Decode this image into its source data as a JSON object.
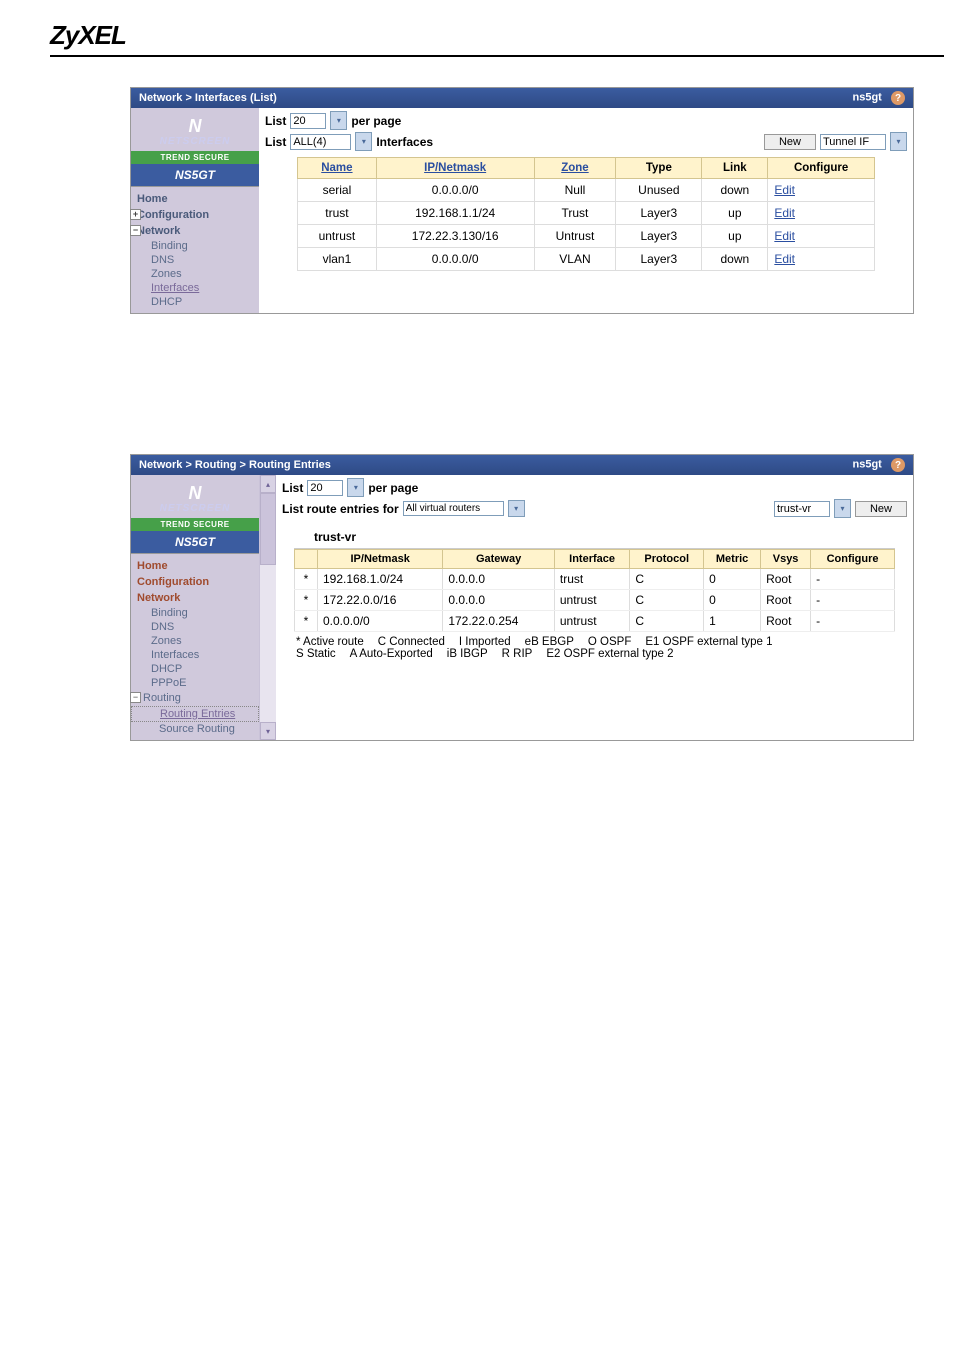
{
  "brand": "ZyXEL",
  "panel1": {
    "breadcrumb": "Network > Interfaces (List)",
    "hostname": "ns5gt",
    "list_label": "List",
    "page_size": "20",
    "per_page": "per page",
    "filter_value": "ALL(4)",
    "section_label": "Interfaces",
    "new_button": "New",
    "type_select": "Tunnel IF",
    "sidebar": {
      "netscreen": "NETSCREEN",
      "trend": "TREND SECURE",
      "model": "NS5GT",
      "items": [
        "Home",
        "Configuration",
        "Network"
      ],
      "network_children": [
        "Binding",
        "DNS",
        "Zones",
        "Interfaces",
        "DHCP"
      ]
    },
    "columns": [
      "Name",
      "IP/Netmask",
      "Zone",
      "Type",
      "Link",
      "Configure"
    ],
    "rows": [
      {
        "name": "serial",
        "ip": "0.0.0.0/0",
        "zone": "Null",
        "type": "Unused",
        "link": "down",
        "cfg": "Edit"
      },
      {
        "name": "trust",
        "ip": "192.168.1.1/24",
        "zone": "Trust",
        "type": "Layer3",
        "link": "up",
        "cfg": "Edit"
      },
      {
        "name": "untrust",
        "ip": "172.22.3.130/16",
        "zone": "Untrust",
        "type": "Layer3",
        "link": "up",
        "cfg": "Edit"
      },
      {
        "name": "vlan1",
        "ip": "0.0.0.0/0",
        "zone": "VLAN",
        "type": "Layer3",
        "link": "down",
        "cfg": "Edit"
      }
    ]
  },
  "panel2": {
    "breadcrumb": "Network > Routing > Routing Entries",
    "hostname": "ns5gt",
    "list_label": "List",
    "page_size": "20",
    "per_page": "per page",
    "route_label": "List route entries for",
    "route_filter": "All virtual routers",
    "vr_select": "trust-vr",
    "new_button": "New",
    "vr_name": "trust-vr",
    "sidebar": {
      "netscreen": "NETSCREEN",
      "trend": "TREND SECURE",
      "model": "NS5GT",
      "items": [
        "Home",
        "Configuration",
        "Network"
      ],
      "network_children": [
        "Binding",
        "DNS",
        "Zones",
        "Interfaces",
        "DHCP",
        "PPPoE",
        "Routing"
      ],
      "routing_children": [
        "Routing Entries",
        "Source Routing"
      ]
    },
    "columns": [
      "",
      "IP/Netmask",
      "Gateway",
      "Interface",
      "Protocol",
      "Metric",
      "Vsys",
      "Configure"
    ],
    "rows": [
      {
        "mark": "*",
        "ip": "192.168.1.0/24",
        "gw": "0.0.0.0",
        "iface": "trust",
        "proto": "C",
        "metric": "0",
        "vsys": "Root",
        "cfg": "-"
      },
      {
        "mark": "*",
        "ip": "172.22.0.0/16",
        "gw": "0.0.0.0",
        "iface": "untrust",
        "proto": "C",
        "metric": "0",
        "vsys": "Root",
        "cfg": "-"
      },
      {
        "mark": "*",
        "ip": "0.0.0.0/0",
        "gw": "172.22.0.254",
        "iface": "untrust",
        "proto": "C",
        "metric": "1",
        "vsys": "Root",
        "cfg": "-"
      }
    ],
    "legend": {
      "l0": "* Active route",
      "l1": "C Connected",
      "l2": "S Static",
      "l3": "I  Imported",
      "l4": "A Auto-Exported",
      "l5": "eB EBGP",
      "l6": "iB  IBGP",
      "l7": "O OSPF",
      "l8": "R RIP",
      "l9": "E1 OSPF external type 1",
      "l10": "E2 OSPF external type 2"
    }
  }
}
